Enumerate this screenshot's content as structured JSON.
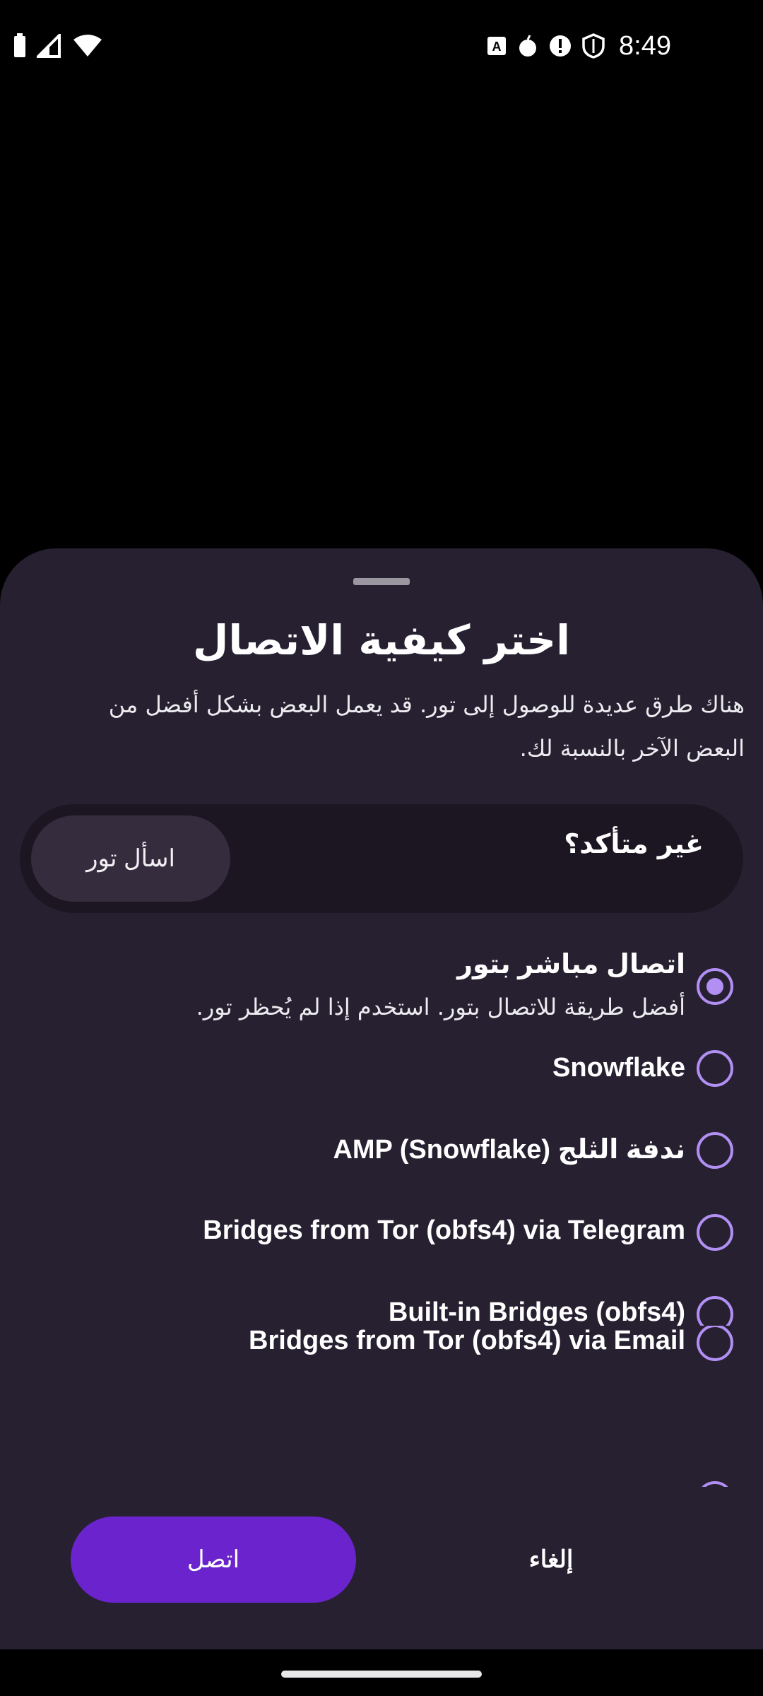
{
  "status_bar": {
    "time": "8:49",
    "left_icons": [
      "battery-icon",
      "signal-icon",
      "wifi-icon"
    ],
    "right_icons": [
      "text-notification-icon",
      "onion-icon",
      "alert-icon",
      "vpn-shield-icon"
    ]
  },
  "sheet": {
    "title": "اختر كيفية الاتصال",
    "description": "هناك طرق عديدة للوصول إلى تور. قد يعمل البعض بشكل أفضل من البعض الآخر بالنسبة لك."
  },
  "ask_card": {
    "label": "غير متأكد؟",
    "button_label": "اسأل تور"
  },
  "options": [
    {
      "label": "اتصال مباشر بتور",
      "sublabel": "أفضل طريقة للاتصال بتور. استخدم إذا لم يُحظر تور.",
      "selected": true
    },
    {
      "label": "Snowflake",
      "selected": false
    },
    {
      "label": "ندفة الثلج (AMP (Snowflake",
      "selected": false
    },
    {
      "label": "Bridges from Tor (obfs4) via Telegram",
      "selected": false
    },
    {
      "label": "Built-in Bridges (obfs4)",
      "selected": false
    },
    {
      "label": "Bridges from Tor (obfs4) via Email",
      "selected": false
    }
  ],
  "actions": {
    "connect_label": "اتصل",
    "cancel_label": "إلغاء"
  },
  "colors": {
    "sheet_bg": "#272031",
    "accent": "#b18ff3",
    "primary_button": "#6b24cd"
  }
}
